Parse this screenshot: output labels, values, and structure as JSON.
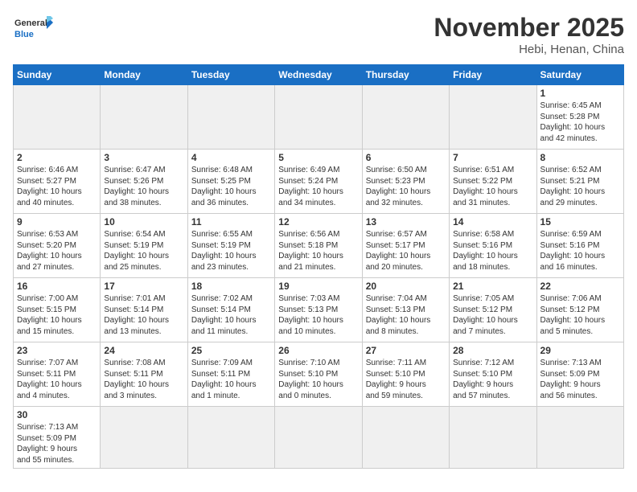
{
  "header": {
    "logo_general": "General",
    "logo_blue": "Blue",
    "month_title": "November 2025",
    "location": "Hebi, Henan, China"
  },
  "weekdays": [
    "Sunday",
    "Monday",
    "Tuesday",
    "Wednesday",
    "Thursday",
    "Friday",
    "Saturday"
  ],
  "weeks": [
    [
      {
        "day": "",
        "info": ""
      },
      {
        "day": "",
        "info": ""
      },
      {
        "day": "",
        "info": ""
      },
      {
        "day": "",
        "info": ""
      },
      {
        "day": "",
        "info": ""
      },
      {
        "day": "",
        "info": ""
      },
      {
        "day": "1",
        "info": "Sunrise: 6:45 AM\nSunset: 5:28 PM\nDaylight: 10 hours\nand 42 minutes."
      }
    ],
    [
      {
        "day": "2",
        "info": "Sunrise: 6:46 AM\nSunset: 5:27 PM\nDaylight: 10 hours\nand 40 minutes."
      },
      {
        "day": "3",
        "info": "Sunrise: 6:47 AM\nSunset: 5:26 PM\nDaylight: 10 hours\nand 38 minutes."
      },
      {
        "day": "4",
        "info": "Sunrise: 6:48 AM\nSunset: 5:25 PM\nDaylight: 10 hours\nand 36 minutes."
      },
      {
        "day": "5",
        "info": "Sunrise: 6:49 AM\nSunset: 5:24 PM\nDaylight: 10 hours\nand 34 minutes."
      },
      {
        "day": "6",
        "info": "Sunrise: 6:50 AM\nSunset: 5:23 PM\nDaylight: 10 hours\nand 32 minutes."
      },
      {
        "day": "7",
        "info": "Sunrise: 6:51 AM\nSunset: 5:22 PM\nDaylight: 10 hours\nand 31 minutes."
      },
      {
        "day": "8",
        "info": "Sunrise: 6:52 AM\nSunset: 5:21 PM\nDaylight: 10 hours\nand 29 minutes."
      }
    ],
    [
      {
        "day": "9",
        "info": "Sunrise: 6:53 AM\nSunset: 5:20 PM\nDaylight: 10 hours\nand 27 minutes."
      },
      {
        "day": "10",
        "info": "Sunrise: 6:54 AM\nSunset: 5:19 PM\nDaylight: 10 hours\nand 25 minutes."
      },
      {
        "day": "11",
        "info": "Sunrise: 6:55 AM\nSunset: 5:19 PM\nDaylight: 10 hours\nand 23 minutes."
      },
      {
        "day": "12",
        "info": "Sunrise: 6:56 AM\nSunset: 5:18 PM\nDaylight: 10 hours\nand 21 minutes."
      },
      {
        "day": "13",
        "info": "Sunrise: 6:57 AM\nSunset: 5:17 PM\nDaylight: 10 hours\nand 20 minutes."
      },
      {
        "day": "14",
        "info": "Sunrise: 6:58 AM\nSunset: 5:16 PM\nDaylight: 10 hours\nand 18 minutes."
      },
      {
        "day": "15",
        "info": "Sunrise: 6:59 AM\nSunset: 5:16 PM\nDaylight: 10 hours\nand 16 minutes."
      }
    ],
    [
      {
        "day": "16",
        "info": "Sunrise: 7:00 AM\nSunset: 5:15 PM\nDaylight: 10 hours\nand 15 minutes."
      },
      {
        "day": "17",
        "info": "Sunrise: 7:01 AM\nSunset: 5:14 PM\nDaylight: 10 hours\nand 13 minutes."
      },
      {
        "day": "18",
        "info": "Sunrise: 7:02 AM\nSunset: 5:14 PM\nDaylight: 10 hours\nand 11 minutes."
      },
      {
        "day": "19",
        "info": "Sunrise: 7:03 AM\nSunset: 5:13 PM\nDaylight: 10 hours\nand 10 minutes."
      },
      {
        "day": "20",
        "info": "Sunrise: 7:04 AM\nSunset: 5:13 PM\nDaylight: 10 hours\nand 8 minutes."
      },
      {
        "day": "21",
        "info": "Sunrise: 7:05 AM\nSunset: 5:12 PM\nDaylight: 10 hours\nand 7 minutes."
      },
      {
        "day": "22",
        "info": "Sunrise: 7:06 AM\nSunset: 5:12 PM\nDaylight: 10 hours\nand 5 minutes."
      }
    ],
    [
      {
        "day": "23",
        "info": "Sunrise: 7:07 AM\nSunset: 5:11 PM\nDaylight: 10 hours\nand 4 minutes."
      },
      {
        "day": "24",
        "info": "Sunrise: 7:08 AM\nSunset: 5:11 PM\nDaylight: 10 hours\nand 3 minutes."
      },
      {
        "day": "25",
        "info": "Sunrise: 7:09 AM\nSunset: 5:11 PM\nDaylight: 10 hours\nand 1 minute."
      },
      {
        "day": "26",
        "info": "Sunrise: 7:10 AM\nSunset: 5:10 PM\nDaylight: 10 hours\nand 0 minutes."
      },
      {
        "day": "27",
        "info": "Sunrise: 7:11 AM\nSunset: 5:10 PM\nDaylight: 9 hours\nand 59 minutes."
      },
      {
        "day": "28",
        "info": "Sunrise: 7:12 AM\nSunset: 5:10 PM\nDaylight: 9 hours\nand 57 minutes."
      },
      {
        "day": "29",
        "info": "Sunrise: 7:13 AM\nSunset: 5:09 PM\nDaylight: 9 hours\nand 56 minutes."
      }
    ],
    [
      {
        "day": "30",
        "info": "Sunrise: 7:13 AM\nSunset: 5:09 PM\nDaylight: 9 hours\nand 55 minutes."
      },
      {
        "day": "",
        "info": ""
      },
      {
        "day": "",
        "info": ""
      },
      {
        "day": "",
        "info": ""
      },
      {
        "day": "",
        "info": ""
      },
      {
        "day": "",
        "info": ""
      },
      {
        "day": "",
        "info": ""
      }
    ]
  ]
}
